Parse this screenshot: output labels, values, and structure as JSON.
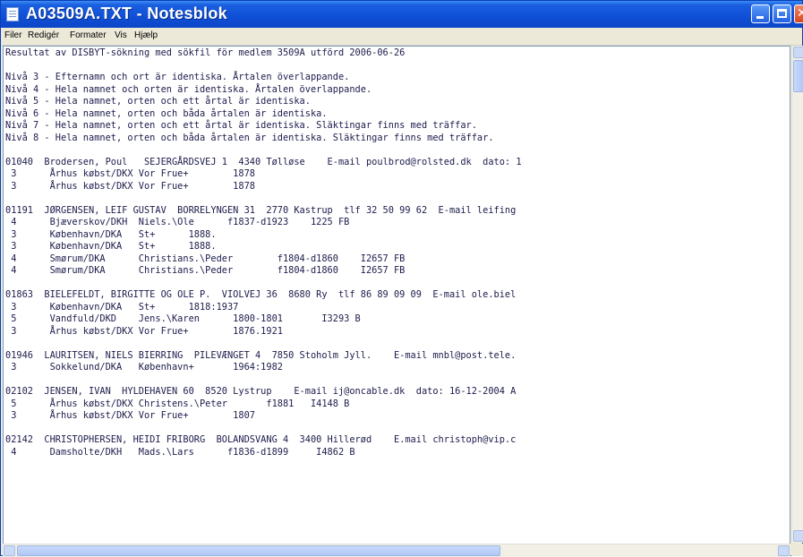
{
  "window": {
    "title": "A03509A.TXT - Notesblok"
  },
  "menu": [
    "Filer",
    "Redigér",
    "Formater",
    "Vis",
    "Hjælp"
  ],
  "document": {
    "lines": [
      "Resultat av DISBYT-sökning med sökfil för medlem 3509A utförd 2006-06-26",
      "",
      "Nivå 3 - Efternamn och ort är identiska. Årtalen överlappande.",
      "Nivå 4 - Hela namnet och orten är identiska. Årtalen överlappande.",
      "Nivå 5 - Hela namnet, orten och ett årtal är identiska.",
      "Nivå 6 - Hela namnet, orten och båda årtalen är identiska.",
      "Nivå 7 - Hela namnet, orten och ett årtal är identiska. Släktingar finns med träffar.",
      "Nivå 8 - Hela namnet, orten och båda årtalen är identiska. Släktingar finns med träffar.",
      "",
      "01040  Brodersen, Poul   SEJERGÅRDSVEJ 1  4340 Tølløse    E-mail poulbrod@rolsted.dk  dato: 1",
      " 3      Århus købst/DKX Vor Frue+        1878",
      " 3      Århus købst/DKX Vor Frue+        1878",
      "",
      "01191  JØRGENSEN, LEIF GUSTAV  BORRELYNGEN 31  2770 Kastrup  tlf 32 50 99 62  E-mail leifing",
      " 4      Bjæverskov/DKH  Niels.\\Ole      f1837-d1923    1225 FB",
      " 3      København/DKA   St+      1888.",
      " 3      København/DKA   St+      1888.",
      " 4      Smørum/DKA      Christians.\\Peder        f1804-d1860    I2657 FB",
      " 4      Smørum/DKA      Christians.\\Peder        f1804-d1860    I2657 FB",
      "",
      "01863  BIELEFELDT, BIRGITTE OG OLE P.  VIOLVEJ 36  8680 Ry  tlf 86 89 09 09  E-mail ole.biel",
      " 3      København/DKA   St+      1818:1937",
      " 5      Vandfuld/DKD    Jens.\\Karen      1800-1801       I3293 B",
      " 3      Århus købst/DKX Vor Frue+        1876.1921",
      "",
      "01946  LAURITSEN, NIELS BIERRING  PILEVÆNGET 4  7850 Stoholm Jyll.    E-mail mnbl@post.tele.",
      " 3      Sokkelund/DKA   København+       1964:1982",
      "",
      "02102  JENSEN, IVAN  HYLDEHAVEN 60  8520 Lystrup    E-mail ij@oncable.dk  dato: 16-12-2004 A",
      " 5      Århus købst/DKX Christens.\\Peter       f1881   I4148 B",
      " 3      Århus købst/DKX Vor Frue+        1807",
      "",
      "02142  CHRISTOPHERSEN, HEIDI FRIBORG  BOLANDSVANG 4  3400 Hillerød    E.mail christoph@vip.c",
      " 4      Damsholte/DKH   Mads.\\Lars      f1836-d1899     I4862 B"
    ]
  }
}
